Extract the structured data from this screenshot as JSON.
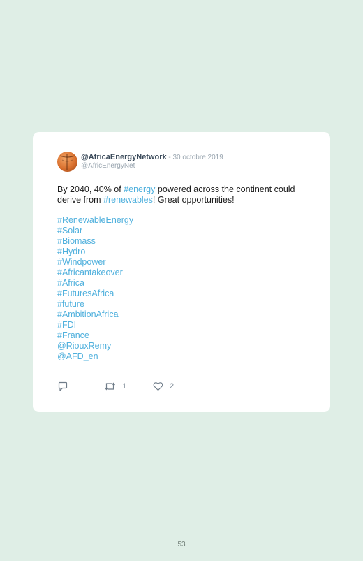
{
  "tweet": {
    "display_name": "@AfricaEnergyNetwork",
    "separator": " - ",
    "date": "30 octobre 2019",
    "handle": "@AfricEnergyNet",
    "text_1": "By 2040, 40% of ",
    "link_energy": "#energy",
    "text_2": " powered across the continent could derive from ",
    "link_renewables": "#renewables",
    "text_3": "! Great opportunities!",
    "hashtags": [
      "#RenewableEnergy",
      "#Solar",
      "#Biomass",
      "#Hydro",
      "#Windpower",
      "#Africantakeover",
      "#Africa",
      "#FuturesAfrica",
      "#future",
      "#AmbitionAfrica",
      "#FDI",
      "#France",
      "@RiouxRemy",
      "@AFD_en"
    ],
    "retweet_count": "1",
    "like_count": "2"
  },
  "page": {
    "number": "53"
  },
  "colors": {
    "background": "#dfeee6",
    "card": "#ffffff",
    "link": "#4fb0dd",
    "name": "#3a4a5a",
    "muted": "#9aa6b0"
  },
  "icons": {
    "reply": "reply-icon",
    "retweet": "retweet-icon",
    "like": "heart-icon"
  }
}
